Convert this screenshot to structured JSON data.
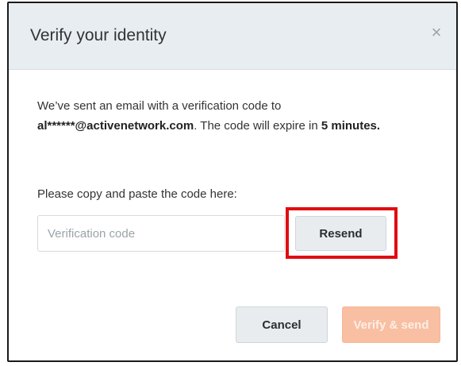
{
  "dialog": {
    "title": "Verify your identity",
    "close_glyph": "×",
    "close_icon": "close-icon"
  },
  "message": {
    "part1": "We’ve sent an email with a verification code to ",
    "email": "al******@activenetwork.com",
    "part2": ". The code will expire in ",
    "duration": "5 minutes."
  },
  "code_section": {
    "prompt": "Please copy and paste the code here:",
    "input_value": "",
    "input_placeholder": "Verification code",
    "resend_label": "Resend"
  },
  "footer": {
    "cancel_label": "Cancel",
    "verify_label": "Verify & send"
  },
  "colors": {
    "header_bg": "#e7edf1",
    "highlight": "#e10c12",
    "primary_disabled": "#f8bfa2",
    "secondary_button": "#e8ecef"
  }
}
